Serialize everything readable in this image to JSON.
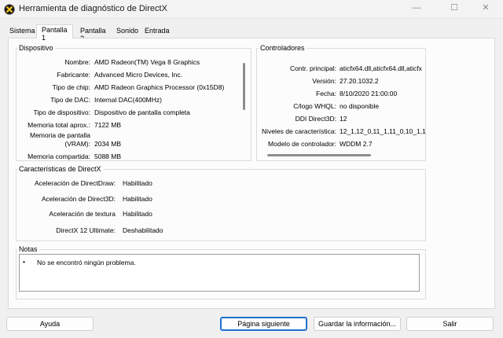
{
  "window": {
    "title": "Herramienta de diagnóstico de DirectX",
    "controls": [
      "—",
      "☐",
      "✕"
    ]
  },
  "tabs": [
    {
      "label": "Sistema"
    },
    {
      "label": "Pantalla 1"
    },
    {
      "label": "Pantalla 2"
    },
    {
      "label": "Sonido"
    },
    {
      "label": "Entrada"
    }
  ],
  "dispositivo": {
    "title": "Dispositivo",
    "rows": [
      {
        "label": "Nombre:",
        "value": "AMD Radeon(TM) Vega 8 Graphics"
      },
      {
        "label": "Fabricante:",
        "value": "Advanced Micro Devices, Inc."
      },
      {
        "label": "Tipo de chip:",
        "value": "AMD Radeon Graphics Processor (0x15D8)"
      },
      {
        "label": "Tipo de DAC:",
        "value": "Internal DAC(400MHz)"
      },
      {
        "label": "Tipo de dispositivo:",
        "value": "Dispositivo de pantalla completa"
      },
      {
        "label": "Memoria total aprox.:",
        "value": "7122 MB"
      },
      {
        "label": "Memoria de pantalla",
        "label2": "(VRAM):",
        "value": "2034 MB"
      },
      {
        "label": "Memoria compartida:",
        "value": "5088 MB"
      }
    ]
  },
  "controladores": {
    "title": "Controladores",
    "rows": [
      {
        "label": "Contr. principal:",
        "value": "aticfx64.dll,aticfx64.dll,aticfx"
      },
      {
        "label": "Versión:",
        "value": "27.20.1032.2"
      },
      {
        "label": "Fecha:",
        "value": "8/10/2020 21:00:00"
      },
      {
        "label": "C/logo WHQL:",
        "value": "no disponible"
      },
      {
        "label": "DDI Direct3D:",
        "value": "12"
      },
      {
        "label": "Niveles de característica:",
        "value": "12_1,12_0,11_1,11_0,10_1,1"
      },
      {
        "label": "Modelo de controlador:",
        "value": "WDDM 2.7"
      }
    ]
  },
  "caracteristicas": {
    "title": "Características de DirectX",
    "rows": [
      {
        "label": "Aceleración de DirectDraw:",
        "value": "Habilitado"
      },
      {
        "label": "Aceleración de Direct3D:",
        "value": "Habilitado"
      },
      {
        "label": "Aceleración de textura",
        "value": "Habilitado"
      },
      {
        "label": "DirectX 12 Ultimate:",
        "value": "Deshabilitado"
      }
    ]
  },
  "notas": {
    "title": "Notas",
    "items": [
      "No se encontró ningún problema."
    ]
  },
  "buttons": {
    "help": "Ayuda",
    "next_page": "Página siguiente",
    "save_info": "Guardar la información...",
    "exit": "Salir"
  },
  "colors": {
    "accent": "#1f6fd1",
    "background": "#f0f0f0",
    "panel": "#fcfcfc"
  }
}
